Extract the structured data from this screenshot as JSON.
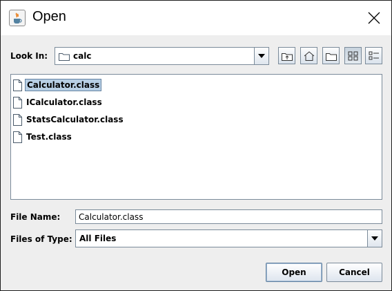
{
  "window": {
    "title": "Open",
    "app_icon": "java-cup-icon",
    "close": "close-icon"
  },
  "look_in": {
    "label": "Look In:",
    "value": "calc",
    "icon": "folder-icon"
  },
  "toolbar": {
    "buttons": [
      {
        "name": "up-one-level-button",
        "icon": "up-folder-icon"
      },
      {
        "name": "home-button",
        "icon": "home-icon"
      },
      {
        "name": "new-folder-button",
        "icon": "new-folder-icon"
      },
      {
        "name": "list-view-button",
        "icon": "list-view-icon",
        "pressed": true
      },
      {
        "name": "details-view-button",
        "icon": "details-view-icon"
      }
    ]
  },
  "files": [
    {
      "name": "Calculator.class",
      "selected": true
    },
    {
      "name": "ICalculator.class",
      "selected": false
    },
    {
      "name": "StatsCalculator.class",
      "selected": false
    },
    {
      "name": "Test.class",
      "selected": false
    }
  ],
  "file_name": {
    "label": "File Name:",
    "value": "Calculator.class"
  },
  "files_of_type": {
    "label": "Files of Type:",
    "value": "All Files"
  },
  "actions": {
    "open": "Open",
    "cancel": "Cancel"
  },
  "colors": {
    "selection": "#b8cfe5",
    "border": "#7a8a99",
    "background": "#eeeeee"
  }
}
